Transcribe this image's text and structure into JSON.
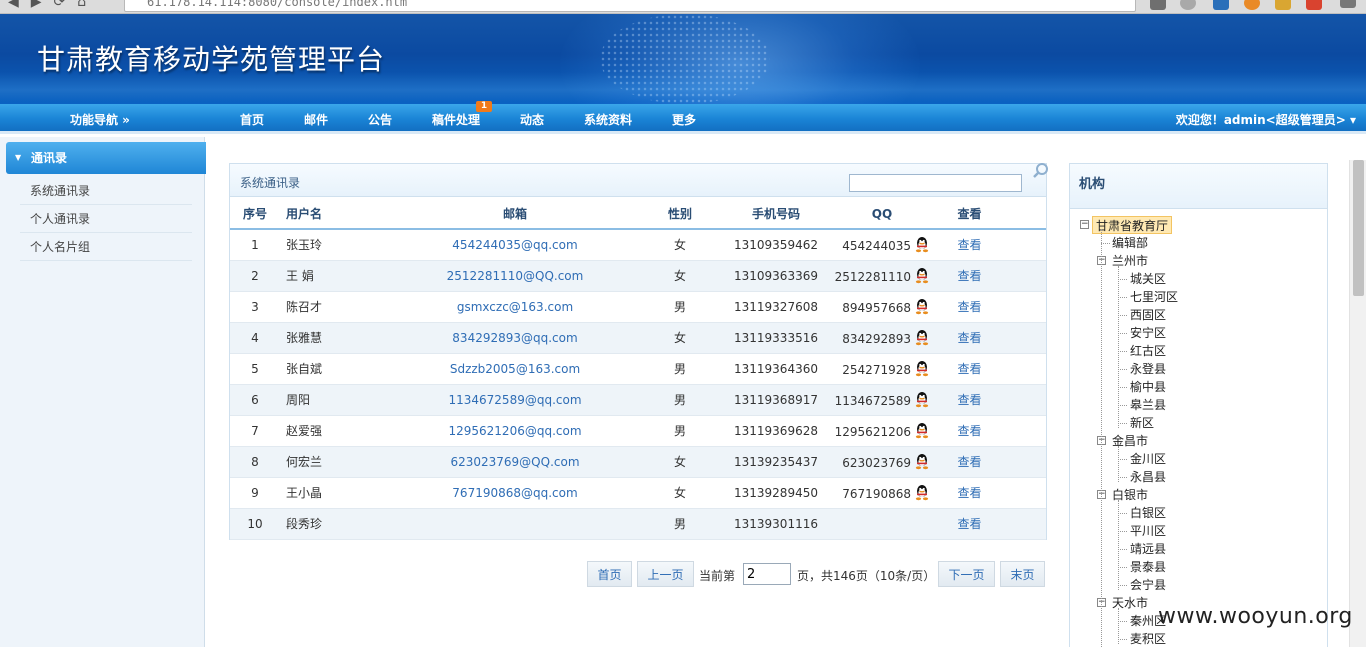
{
  "browser": {
    "address": "61.178.14.114:8080/console/index.htm"
  },
  "header": {
    "title": "甘肃教育移动学苑管理平台"
  },
  "nav": {
    "nav_toggle": "功能导航 »",
    "items": [
      "首页",
      "邮件",
      "公告",
      "稿件处理",
      "动态",
      "系统资料",
      "更多"
    ],
    "badge": "1",
    "welcome": "欢迎您！admin<超级管理员> ▾"
  },
  "sidebar": {
    "head": "通讯录",
    "links": [
      "系统通讯录",
      "个人通讯录",
      "个人名片组"
    ]
  },
  "contacts": {
    "title": "系统通讯录",
    "columns": [
      "序号",
      "用户名",
      "邮箱",
      "性别",
      "手机号码",
      "QQ",
      "查看"
    ],
    "view_label": "查看",
    "rows": [
      {
        "no": "1",
        "name": "张玉玲",
        "email": "454244035@qq.com",
        "gender": "女",
        "phone": "13109359462",
        "qq": "454244035",
        "has_qq": true
      },
      {
        "no": "2",
        "name": "王 娟",
        "email": "2512281110@QQ.com",
        "gender": "女",
        "phone": "13109363369",
        "qq": "2512281110",
        "has_qq": true
      },
      {
        "no": "3",
        "name": "陈召才",
        "email": "gsmxczc@163.com",
        "gender": "男",
        "phone": "13119327608",
        "qq": "894957668",
        "has_qq": true
      },
      {
        "no": "4",
        "name": "张雅慧",
        "email": "834292893@qq.com",
        "gender": "女",
        "phone": "13119333516",
        "qq": "834292893",
        "has_qq": true
      },
      {
        "no": "5",
        "name": "张自斌",
        "email": "Sdzzb2005@163.com",
        "gender": "男",
        "phone": "13119364360",
        "qq": "254271928",
        "has_qq": true
      },
      {
        "no": "6",
        "name": "周阳",
        "email": "1134672589@qq.com",
        "gender": "男",
        "phone": "13119368917",
        "qq": "1134672589",
        "has_qq": true
      },
      {
        "no": "7",
        "name": "赵爱强",
        "email": "1295621206@qq.com",
        "gender": "男",
        "phone": "13119369628",
        "qq": "1295621206",
        "has_qq": true
      },
      {
        "no": "8",
        "name": "何宏兰",
        "email": "623023769@QQ.com",
        "gender": "女",
        "phone": "13139235437",
        "qq": "623023769",
        "has_qq": true
      },
      {
        "no": "9",
        "name": "王小晶",
        "email": "767190868@qq.com",
        "gender": "女",
        "phone": "13139289450",
        "qq": "767190868",
        "has_qq": true
      },
      {
        "no": "10",
        "name": "段秀珍",
        "email": "",
        "gender": "男",
        "phone": "13139301116",
        "qq": "",
        "has_qq": false
      }
    ]
  },
  "pager": {
    "first": "首页",
    "prev": "上一页",
    "current_prefix": "当前第",
    "current_page": "2",
    "summary": "页，共146页（10条/页）",
    "next": "下一页",
    "last": "末页"
  },
  "org": {
    "title": "机构",
    "nodes": [
      {
        "label": "甘肃省教育厅",
        "level": 0,
        "toggle": "−",
        "selected": true
      },
      {
        "label": "编辑部",
        "level": 1
      },
      {
        "label": "兰州市",
        "level": 1,
        "toggle": "−"
      },
      {
        "label": "城关区",
        "level": 2
      },
      {
        "label": "七里河区",
        "level": 2
      },
      {
        "label": "西固区",
        "level": 2
      },
      {
        "label": "安宁区",
        "level": 2
      },
      {
        "label": "红古区",
        "level": 2
      },
      {
        "label": "永登县",
        "level": 2
      },
      {
        "label": "榆中县",
        "level": 2
      },
      {
        "label": "皋兰县",
        "level": 2
      },
      {
        "label": "新区",
        "level": 2
      },
      {
        "label": "金昌市",
        "level": 1,
        "toggle": "−"
      },
      {
        "label": "金川区",
        "level": 2
      },
      {
        "label": "永昌县",
        "level": 2
      },
      {
        "label": "白银市",
        "level": 1,
        "toggle": "−"
      },
      {
        "label": "白银区",
        "level": 2
      },
      {
        "label": "平川区",
        "level": 2
      },
      {
        "label": "靖远县",
        "level": 2
      },
      {
        "label": "景泰县",
        "level": 2
      },
      {
        "label": "会宁县",
        "level": 2
      },
      {
        "label": "天水市",
        "level": 1,
        "toggle": "−"
      },
      {
        "label": "秦州区",
        "level": 2
      },
      {
        "label": "麦积区",
        "level": 2
      }
    ]
  },
  "watermark": "www.wooyun.org",
  "colors": {
    "banner": "#0b4aa1",
    "navbar": "#1a84d6",
    "link": "#2f6db5",
    "badge": "#f07a1a",
    "row_alt": "#eef4f9"
  }
}
